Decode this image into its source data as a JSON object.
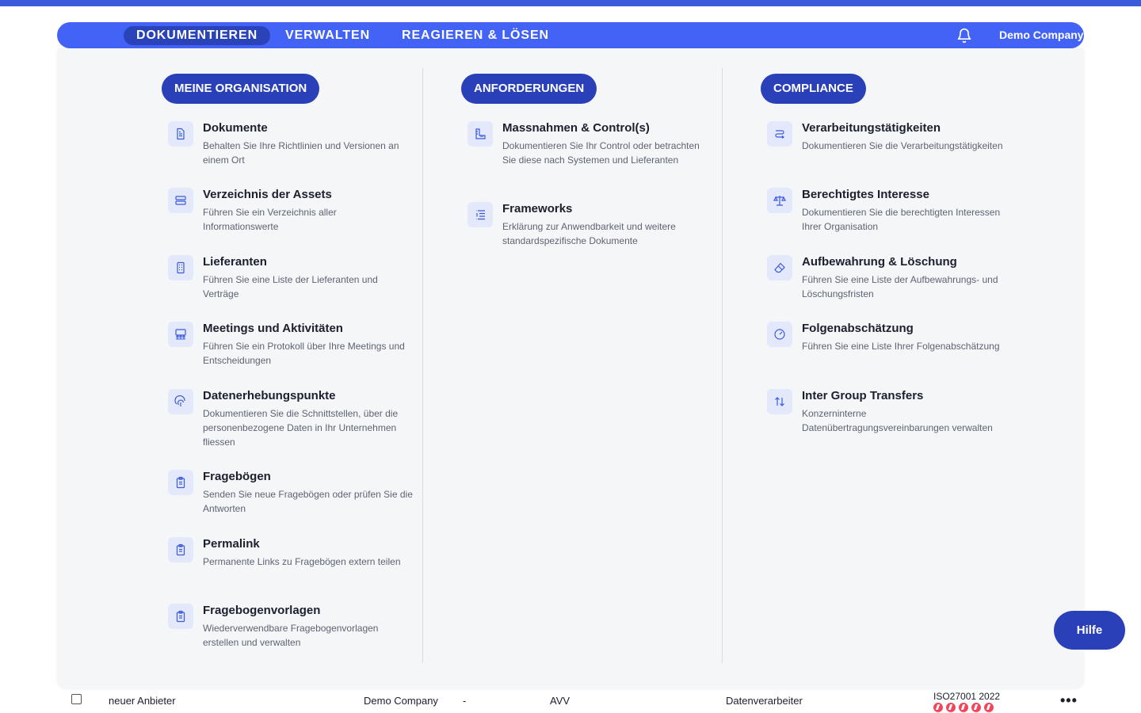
{
  "nav": {
    "tabs": [
      {
        "label": "DOKUMENTIEREN",
        "active": true
      },
      {
        "label": "VERWALTEN",
        "active": false
      },
      {
        "label": "REAGIEREN & LÖSEN",
        "active": false
      }
    ],
    "company": "Demo Company",
    "bell_icon": "bell-icon",
    "settings_icon": "gear-icon"
  },
  "columns": [
    {
      "heading": "MEINE ORGANISATION",
      "items": [
        {
          "title": "Dokumente",
          "desc": "Behalten Sie Ihre Richtlinien und Versionen an einem Ort",
          "icon": "document-icon"
        },
        {
          "title": "Verzeichnis der Assets",
          "desc": "Führen Sie ein Verzeichnis aller Informationswerte",
          "icon": "server-icon"
        },
        {
          "title": "Lieferanten",
          "desc": "Führen Sie eine Liste der Lieferanten und Verträge",
          "icon": "building-icon"
        },
        {
          "title": "Meetings und Aktivitäten",
          "desc": "Führen Sie ein Protokoll über Ihre Meetings und Entscheidungen",
          "icon": "meeting-icon"
        },
        {
          "title": "Datenerhebungspunkte",
          "desc": "Dokumentieren Sie die Schnittstellen, über die personenbezogene Daten in Ihr Unternehmen fliessen",
          "icon": "fingerprint-icon"
        },
        {
          "title": "Fragebögen",
          "desc": "Senden Sie neue Fragebögen oder prüfen Sie die Antworten",
          "icon": "clipboard-icon"
        },
        {
          "title": "Permalink",
          "desc": "Permanente Links zu Fragebögen extern teilen",
          "icon": "clipboard-icon"
        },
        {
          "title": "Fragebogenvorlagen",
          "desc": "Wiederverwendbare Fragebogenvorlagen erstellen und verwalten",
          "icon": "clipboard-icon"
        }
      ]
    },
    {
      "heading": "ANFORDERUNGEN",
      "items": [
        {
          "title": "Massnahmen & Control(s)",
          "desc": "Dokumentieren Sie Ihr Control oder betrachten Sie diese nach Systemen und Lieferanten",
          "icon": "ruler-icon"
        },
        {
          "title": "Frameworks",
          "desc": "Erklärung zur Anwendbarkeit und weitere standardspezifische Dokumente",
          "icon": "list-icon"
        }
      ]
    },
    {
      "heading": "COMPLIANCE",
      "items": [
        {
          "title": "Verarbeitungstätigkeiten",
          "desc": "Dokumentieren Sie die Verarbeitungstätigkeiten",
          "icon": "route-icon"
        },
        {
          "title": "Berechtigtes Interesse",
          "desc": "Dokumentieren Sie die berechtigten Interessen Ihrer Organisation",
          "icon": "scale-icon"
        },
        {
          "title": "Aufbewahrung & Löschung",
          "desc": "Führen Sie eine Liste der Aufbewahrungs- und Löschungsfristen",
          "icon": "eraser-icon"
        },
        {
          "title": "Folgenabschätzung",
          "desc": "Führen Sie eine Liste Ihrer Folgenabschätzung",
          "icon": "gauge-icon"
        },
        {
          "title": "Inter Group Transfers",
          "desc": "Konzerninterne Datenübertragungsvereinbarungen verwalten",
          "icon": "transfer-icon"
        }
      ]
    }
  ],
  "help": {
    "label": "Hilfe"
  },
  "table_row": {
    "name": "neuer Anbieter",
    "company": "Demo Company",
    "dash": "-",
    "type": "AVV",
    "role": "Datenverarbeiter",
    "standard": "ISO27001 2022",
    "status_dots": 5,
    "more_label": "•••"
  },
  "colors": {
    "brand": "#4263f5",
    "brand_dark": "#2a40b8",
    "panel": "#f5f6f8",
    "status_red": "#f0455a"
  }
}
